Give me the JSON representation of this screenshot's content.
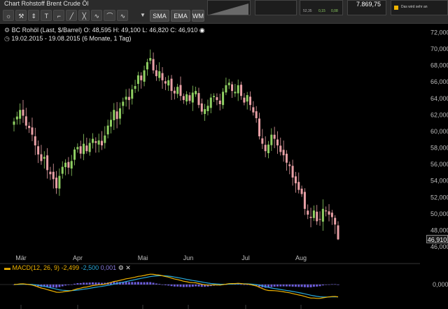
{
  "window": {
    "title": "Chart Rohstoff Brent Crude Öl"
  },
  "toolbar": {
    "buttons": [
      "☼",
      "⚒",
      "⇕",
      "T",
      "⌐",
      "╱",
      "╳",
      "∿",
      "⌒",
      "∿"
    ],
    "indicators": [
      "SMA",
      "EMA",
      "WM"
    ]
  },
  "header_panels": {
    "mid_text": [
      "52,35",
      "0,15",
      "0,08"
    ],
    "big_value": "7.869,75",
    "note": "Das wird sehr an"
  },
  "chart_info": {
    "instrument": "BC Rohöl (Last, $/Barrel)",
    "ohlc": "O: 48,595  H: 49,100  L: 46,820  C: 46,910",
    "range": "19.02.2015 - 19.08.2015 (6 Monate, 1 Tag)",
    "macd_label": "MACD(12, 26, 9)",
    "macd_v1": "-2,499",
    "macd_v2": "-2,500",
    "macd_v3": "0,001",
    "last_price": "46,910"
  },
  "colors": {
    "up": "#8fcf62",
    "down": "#e9a0a6",
    "macd": "#f0b400",
    "signal": "#29a8d8",
    "hist": "#6a5bd6"
  },
  "chart_data": {
    "type": "candlestick",
    "x_axis_labels": [
      "Mär",
      "Apr",
      "Mai",
      "Jun",
      "Jul",
      "Aug"
    ],
    "y_axis_labels": [
      "72,000",
      "70,000",
      "68,000",
      "66,000",
      "64,000",
      "62,000",
      "60,000",
      "58,000",
      "56,000",
      "54,000",
      "52,000",
      "50,000",
      "48,000",
      "46,000"
    ],
    "ylim": [
      46,
      72
    ],
    "macd_axis_label": "0,000",
    "close": [
      61.2,
      61.8,
      62.6,
      61.9,
      60.7,
      60.4,
      59.6,
      58.3,
      57.2,
      56.4,
      56.9,
      55.3,
      54.8,
      54.2,
      53.1,
      54.6,
      55.7,
      56.2,
      55.6,
      56.4,
      57.8,
      58.1,
      57.3,
      58.5,
      57.6,
      58.6,
      59.1,
      58.6,
      58.9,
      58.3,
      59.5,
      60.7,
      61.4,
      62.6,
      61.5,
      62.8,
      63.6,
      64.2,
      63.8,
      65.1,
      65.5,
      66.8,
      66.2,
      67.4,
      68.4,
      68.9,
      67.4,
      66.7,
      67.3,
      66.2,
      65.8,
      66.2,
      64.9,
      64.6,
      65.4,
      64.3,
      63.8,
      64.5,
      63.7,
      64.7,
      64.9,
      63.2,
      62.4,
      62.7,
      63.1,
      64.1,
      64.3,
      63.8,
      63.3,
      64.8,
      65.6,
      65.9,
      64.9,
      64.8,
      65.6,
      64.3,
      63.5,
      64.4,
      63.2,
      62.3,
      61.6,
      59.4,
      58.5,
      57.6,
      58.4,
      59.6,
      59.1,
      58.3,
      57.5,
      57.1,
      56.2,
      55.8,
      54.4,
      53.7,
      52.9,
      52.4,
      50.6,
      49.9,
      49.5,
      50.4,
      49.1,
      49.3,
      50.6,
      50.3,
      49.9,
      49.6,
      48.7,
      46.9
    ],
    "ohlc": {
      "O": 48.595,
      "H": 49.1,
      "L": 46.82,
      "C": 46.91
    },
    "macd": {
      "macd": -2.499,
      "signal": -2.5,
      "hist": 0.001
    }
  }
}
